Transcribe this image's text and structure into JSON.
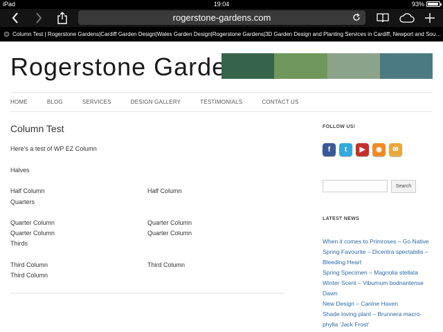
{
  "statusbar": {
    "device": "iPad",
    "time": "19:04",
    "battery_text": "93%",
    "battery_level": 0.93
  },
  "toolbar": {
    "url": "rogerstone-gardens.com"
  },
  "tab": {
    "title": "Column Test | Rogerstone Gardens|Cardiff Garden Design|Wales Garden Design|Rogerstone Gardens|3D Garden Design and Planting Services in Cardiff, Newport and Sout..."
  },
  "site": {
    "logo": "Rogerstone Gardens",
    "swatch_colors": [
      "#36644a",
      "#6f975c",
      "#8ba38a",
      "#4c7a82"
    ],
    "nav": [
      "HOME",
      "BLOG",
      "SERVICES",
      "DESIGN GALLERY",
      "TESTIMONIALS",
      "CONTACT US"
    ]
  },
  "content": {
    "title": "Column Test",
    "intro": "Here’s a test of WP EZ Column",
    "halves_heading": "Halves",
    "half_col_left": "Half Column",
    "half_col_right": "Half Column",
    "quarters_heading": "Quarters",
    "quarter_1": "Quarter Column",
    "quarter_2": "Quarter Column",
    "quarter_3": "Quarter Column",
    "quarter_4": "Quarter Column",
    "thirds_heading": "Thirds",
    "third_1": "Third Column",
    "third_2": "Third Column",
    "third_3": "Third Column"
  },
  "sidebar": {
    "follow_title": "FOLLOW US!",
    "social": [
      {
        "name": "facebook",
        "glyph": "f",
        "color": "#3b5998"
      },
      {
        "name": "twitter",
        "glyph": "t",
        "color": "#33aadd"
      },
      {
        "name": "youtube",
        "glyph": "▶",
        "color": "#c4302b"
      },
      {
        "name": "rss",
        "glyph": "◉",
        "color": "#f18a22"
      },
      {
        "name": "email",
        "glyph": "✉",
        "color": "#e8a93a"
      }
    ],
    "search_button": "Search",
    "news_title": "LATEST NEWS",
    "news": [
      "When it comes to Primroses – Go Native",
      "Spring Favourite – Dicentra spectabilis –",
      "Bleeding Heart",
      "Spring Specimen – Magnolia stellata",
      "Winter Scent – Viburnum bodnantense",
      "Dawn",
      "New Design – Canine Haven",
      "Shade loving plant – Brunnera macro-",
      "phylla ‘Jack Frost’"
    ]
  }
}
